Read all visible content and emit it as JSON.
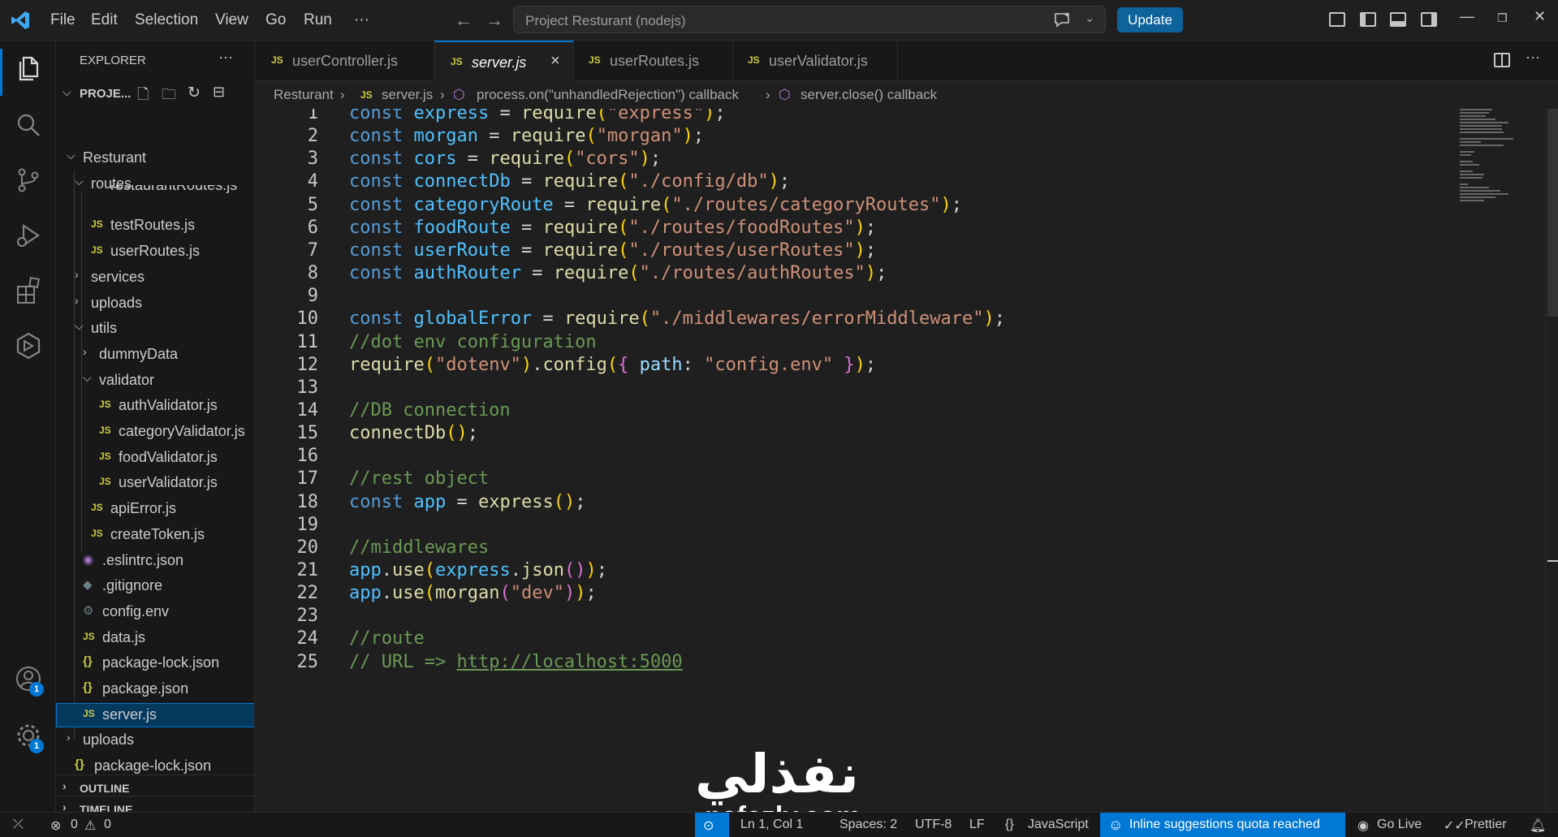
{
  "titlebar": {
    "menus": [
      "File",
      "Edit",
      "Selection",
      "View",
      "Go",
      "Run",
      "···"
    ],
    "search_placeholder": "Project Resturant (nodejs)",
    "update_label": "Update",
    "back_icon": "←",
    "forward_icon": "→"
  },
  "sidebar": {
    "title": "EXPLORER",
    "more": "···",
    "project": "PROJE...",
    "items": [
      {
        "label": "Resturant",
        "kind": "folder-open",
        "indent": 0
      },
      {
        "label": "routes",
        "kind": "folder-open",
        "indent": 1
      },
      {
        "label": "restaurantRoutes.js",
        "kind": "js-partial",
        "indent": 2
      },
      {
        "label": "testRoutes.js",
        "kind": "js",
        "indent": 2
      },
      {
        "label": "userRoutes.js",
        "kind": "js",
        "indent": 2
      },
      {
        "label": "services",
        "kind": "folder",
        "indent": 1
      },
      {
        "label": "uploads",
        "kind": "folder",
        "indent": 1
      },
      {
        "label": "utils",
        "kind": "folder-open",
        "indent": 1
      },
      {
        "label": "dummyData",
        "kind": "folder",
        "indent": 2
      },
      {
        "label": "validator",
        "kind": "folder-open",
        "indent": 2
      },
      {
        "label": "authValidator.js",
        "kind": "js",
        "indent": 3
      },
      {
        "label": "categoryValidator.js",
        "kind": "js",
        "indent": 3
      },
      {
        "label": "foodValidator.js",
        "kind": "js",
        "indent": 3
      },
      {
        "label": "userValidator.js",
        "kind": "js",
        "indent": 3
      },
      {
        "label": "apiError.js",
        "kind": "js",
        "indent": 2
      },
      {
        "label": "createToken.js",
        "kind": "js",
        "indent": 2
      },
      {
        "label": ".eslintrc.json",
        "kind": "eslint",
        "indent": 1
      },
      {
        "label": ".gitignore",
        "kind": "git",
        "indent": 1
      },
      {
        "label": "config.env",
        "kind": "gear",
        "indent": 1
      },
      {
        "label": "data.js",
        "kind": "js",
        "indent": 1
      },
      {
        "label": "package-lock.json",
        "kind": "json",
        "indent": 1
      },
      {
        "label": "package.json",
        "kind": "json",
        "indent": 1
      },
      {
        "label": "server.js",
        "kind": "js",
        "indent": 1,
        "selected": true
      },
      {
        "label": "uploads",
        "kind": "folder",
        "indent": 0
      },
      {
        "label": "package-lock.json",
        "kind": "json",
        "indent": 0
      }
    ],
    "outline": "OUTLINE",
    "timeline": "TIMELINE"
  },
  "tabs": [
    {
      "label": "userController.js",
      "active": false
    },
    {
      "label": "server.js",
      "active": true
    },
    {
      "label": "userRoutes.js",
      "active": false
    },
    {
      "label": "userValidator.js",
      "active": false
    }
  ],
  "breadcrumbs": [
    "Resturant",
    "server.js",
    "process.on(\"unhandledRejection\") callback",
    "server.close() callback"
  ],
  "editor": {
    "lines": [
      {
        "n": "1",
        "code": "const express = require(\"express\");"
      },
      {
        "n": "2",
        "code": "const morgan = require(\"morgan\");"
      },
      {
        "n": "3",
        "code": "const cors = require(\"cors\");"
      },
      {
        "n": "4",
        "code": "const connectDb = require(\"./config/db\");"
      },
      {
        "n": "5",
        "code": "const categoryRoute = require(\"./routes/categoryRoutes\");"
      },
      {
        "n": "6",
        "code": "const foodRoute = require(\"./routes/foodRoutes\");"
      },
      {
        "n": "7",
        "code": "const userRoute = require(\"./routes/userRoutes\");"
      },
      {
        "n": "8",
        "code": "const authRouter = require(\"./routes/authRoutes\");"
      },
      {
        "n": "9",
        "code": ""
      },
      {
        "n": "10",
        "code": "const globalError = require(\"./middlewares/errorMiddleware\");"
      },
      {
        "n": "11",
        "code": "//dot env configuration"
      },
      {
        "n": "12",
        "code": "require(\"dotenv\").config({ path: \"config.env\" });"
      },
      {
        "n": "13",
        "code": ""
      },
      {
        "n": "14",
        "code": "//DB connection"
      },
      {
        "n": "15",
        "code": "connectDb();"
      },
      {
        "n": "16",
        "code": ""
      },
      {
        "n": "17",
        "code": "//rest object"
      },
      {
        "n": "18",
        "code": "const app = express();"
      },
      {
        "n": "19",
        "code": ""
      },
      {
        "n": "20",
        "code": "//middlewares"
      },
      {
        "n": "21",
        "code": "app.use(express.json());"
      },
      {
        "n": "22",
        "code": "app.use(morgan(\"dev\"));"
      },
      {
        "n": "23",
        "code": ""
      },
      {
        "n": "24",
        "code": "//route"
      },
      {
        "n": "25",
        "code": "// URL => http://localhost:5000"
      }
    ]
  },
  "statusbar": {
    "errors": "0",
    "warnings": "0",
    "position": "Ln 1, Col 1",
    "spaces": "Spaces: 2",
    "encoding": "UTF-8",
    "eol": "LF",
    "language": "JavaScript",
    "copilot": "Inline suggestions quota reached",
    "golive": "Go Live",
    "prettier": "Prettier"
  },
  "activity_badges": {
    "accounts": "1",
    "settings": "1"
  },
  "watermark": {
    "arabic": "نفذلي",
    "latin": "nafezly.com"
  },
  "colors": {
    "accent": "#0078d4",
    "update": "#0e639c",
    "js_icon": "#cbcb41",
    "keyword": "#569cd6",
    "string": "#ce9178",
    "comment": "#6a9955",
    "function": "#dcdcaa"
  }
}
